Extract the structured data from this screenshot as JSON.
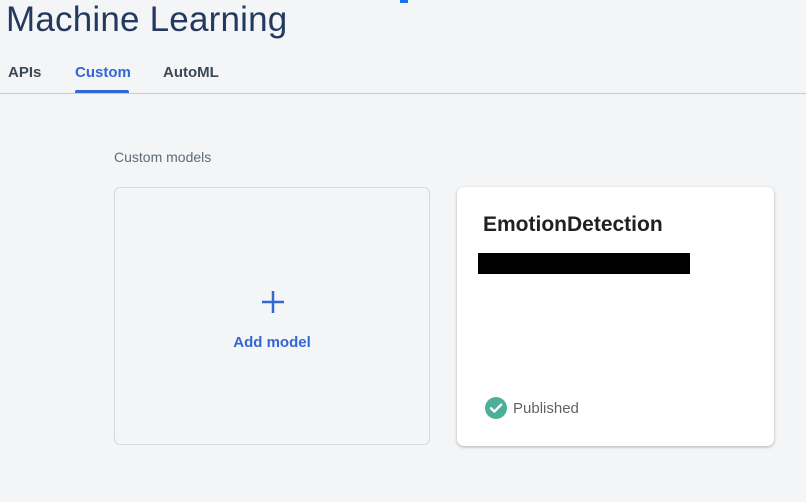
{
  "page": {
    "title": "Machine Learning"
  },
  "tabs": [
    {
      "label": "APIs",
      "active": false
    },
    {
      "label": "Custom",
      "active": true
    },
    {
      "label": "AutoML",
      "active": false
    }
  ],
  "custom_models": {
    "section_label": "Custom models",
    "add_card": {
      "label": "Add model",
      "icon": "plus-icon"
    },
    "models": [
      {
        "name": "EmotionDetection",
        "status": "Published",
        "status_icon": "check-circle-icon"
      }
    ]
  },
  "colors": {
    "accent": "#3367d6",
    "title": "#233a5e",
    "published": "#4caf97",
    "background": "#f4f5f7"
  }
}
